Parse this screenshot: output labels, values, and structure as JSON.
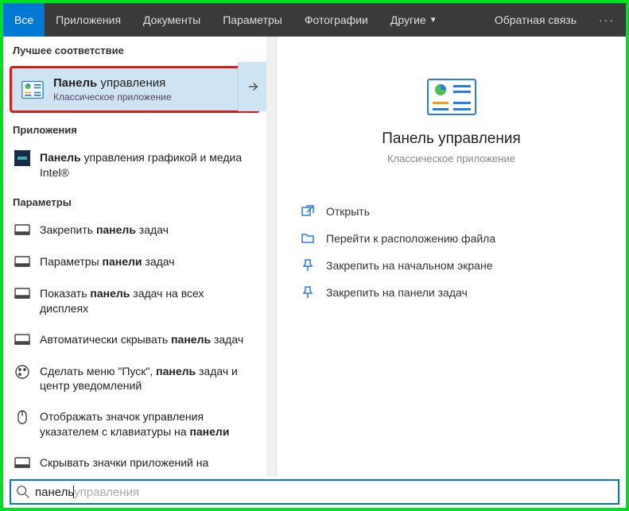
{
  "tabs": {
    "all": "Все",
    "apps": "Приложения",
    "docs": "Документы",
    "params": "Параметры",
    "photos": "Фотографии",
    "other": "Другие"
  },
  "feedback": "Обратная связь",
  "sections": {
    "best": "Лучшее соответствие",
    "apps": "Приложения",
    "params": "Параметры"
  },
  "bestMatch": {
    "title": "Панель управления",
    "subtitle": "Классическое приложение"
  },
  "apps": [
    {
      "html": "<b>Панель</b> управления графикой и медиа Intel®"
    }
  ],
  "params": [
    {
      "html": "Закрепить <b>панель</b> задач"
    },
    {
      "html": "Параметры <b>панели</b> задач"
    },
    {
      "html": "Показать <b>панель</b> задач на всех дисплеях"
    },
    {
      "html": "Автоматически скрывать <b>панель</b> задач"
    },
    {
      "html": "Сделать меню \"Пуск\", <b>панель</b> задач и центр уведомлений"
    },
    {
      "html": "Отображать значок управления указателем с клавиатуры на <b>панели</b>"
    },
    {
      "html": "Скрывать значки приложений на"
    }
  ],
  "preview": {
    "title": "Панель управления",
    "subtitle": "Классическое приложение"
  },
  "actions": {
    "open": "Открыть",
    "goto": "Перейти к расположению файла",
    "pinStart": "Закрепить на начальном экране",
    "pinTask": "Закрепить на панели задач"
  },
  "search": {
    "typed": "панель",
    "hint": " управления"
  }
}
